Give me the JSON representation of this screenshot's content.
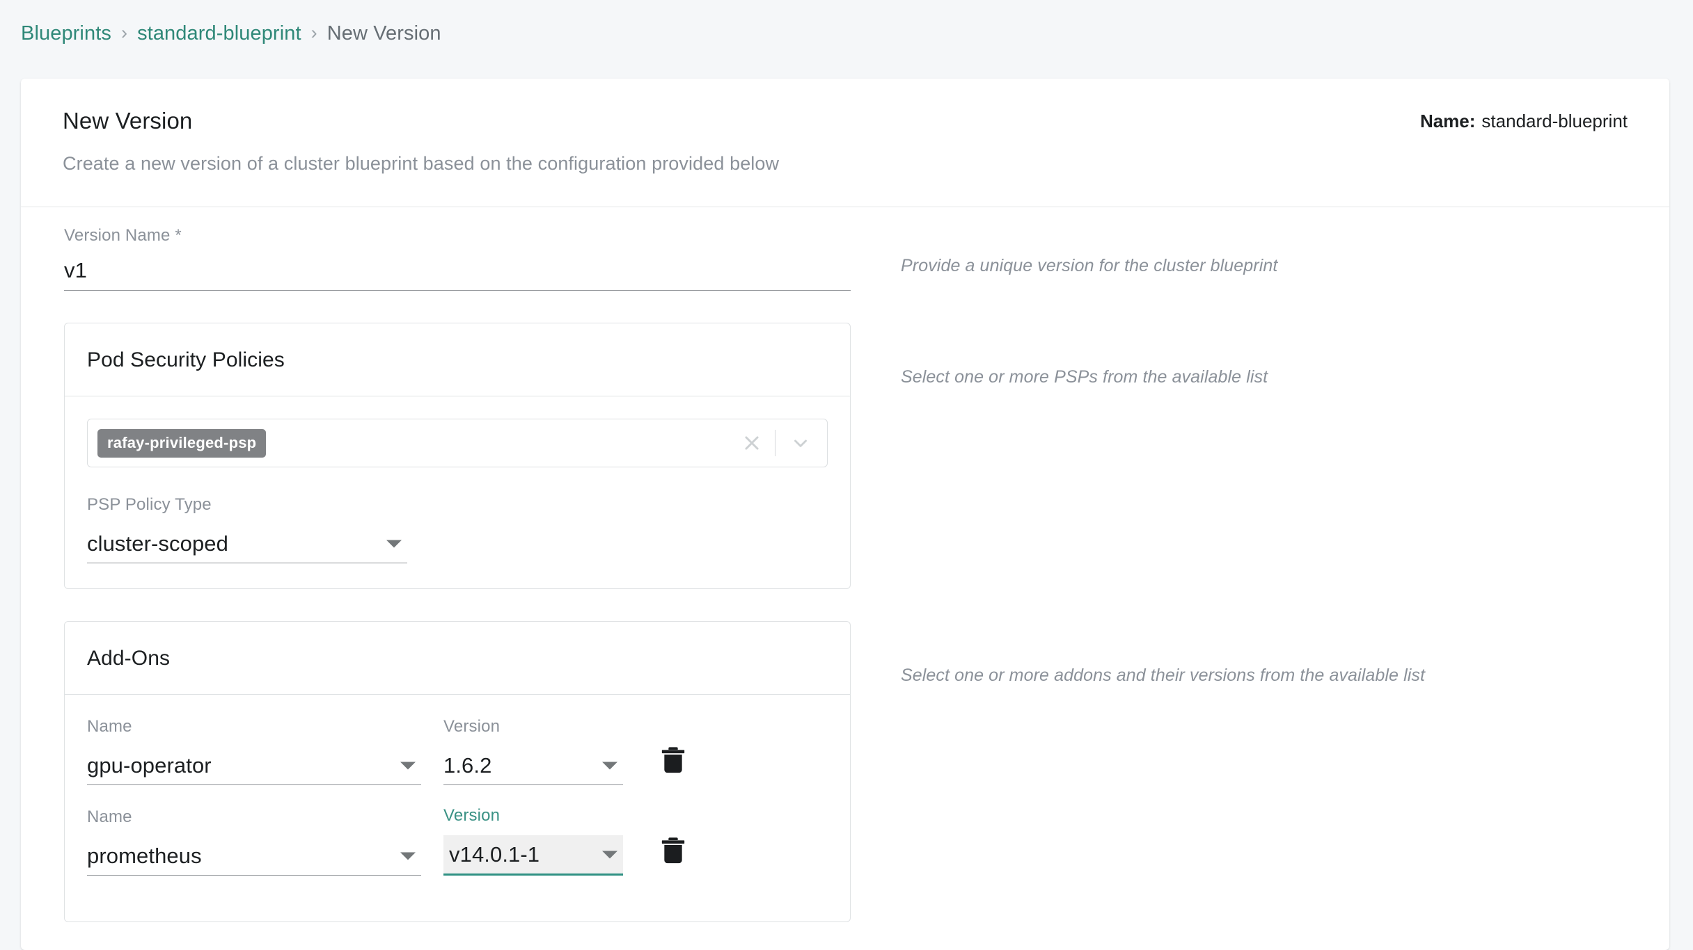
{
  "breadcrumb": {
    "items": [
      {
        "label": "Blueprints",
        "type": "link"
      },
      {
        "label": "standard-blueprint",
        "type": "link"
      },
      {
        "label": "New Version",
        "type": "current"
      }
    ],
    "separator": "›"
  },
  "header": {
    "title": "New Version",
    "subtitle": "Create a new version of a cluster blueprint based on the configuration provided below",
    "name_label": "Name:",
    "name_value": "standard-blueprint"
  },
  "version_name": {
    "label": "Version Name *",
    "value": "v1",
    "hint": "Provide a unique version for the cluster blueprint"
  },
  "pod_security_policies": {
    "title": "Pod Security Policies",
    "hint": "Select one or more PSPs from the available list",
    "selected_chips": [
      "rafay-privileged-psp"
    ],
    "clear_icon": "close-icon",
    "caret_icon": "chevron-down-icon",
    "policy_type": {
      "label": "PSP Policy Type",
      "value": "cluster-scoped"
    }
  },
  "addons": {
    "title": "Add-Ons",
    "hint": "Select one or more addons and their versions from the available list",
    "name_column_label": "Name",
    "version_column_label": "Version",
    "delete_icon": "trash-icon",
    "rows": [
      {
        "name_label": "Name",
        "name_value": "gpu-operator",
        "version_label": "Version",
        "version_value": "1.6.2",
        "version_focused": false
      },
      {
        "name_label": "Name",
        "name_value": "prometheus",
        "version_label": "Version",
        "version_value": "v14.0.1-1",
        "version_focused": true
      }
    ]
  },
  "colors": {
    "accent_teal": "#2f8878",
    "focus_teal": "#3b9285",
    "chip_gray": "#808285",
    "page_bg": "#f5f7f9",
    "muted_text": "#8b9199"
  }
}
